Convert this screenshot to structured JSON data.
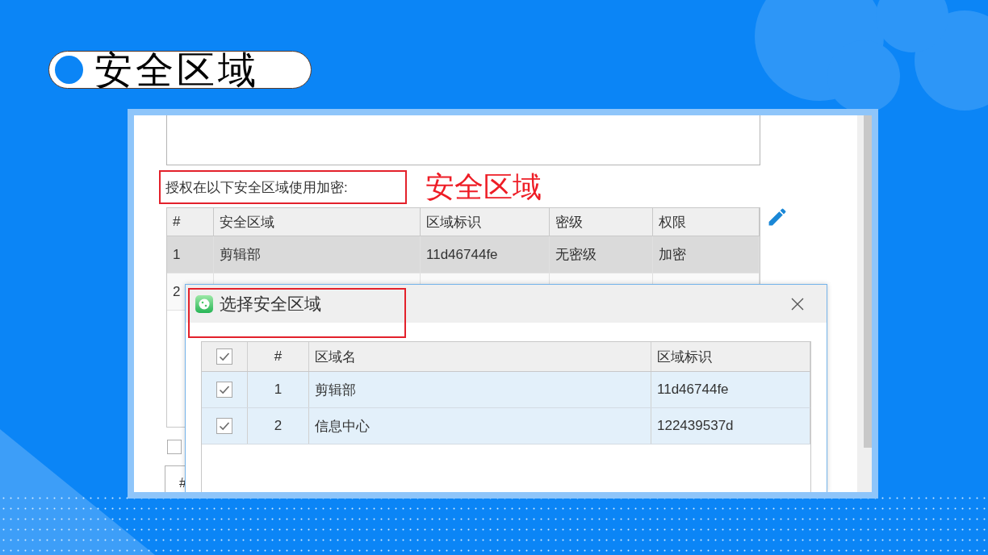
{
  "title_badge": {
    "text": "安全区域"
  },
  "screenshot": {
    "auth_label": "授权在以下安全区域使用加密:",
    "annotation": "安全区域",
    "zones_table": {
      "columns": [
        "#",
        "安全区域",
        "区域标识",
        "密级",
        "权限"
      ],
      "rows": [
        {
          "cells": [
            "1",
            "剪辑部",
            "11d46744fe",
            "无密级",
            "加密"
          ],
          "selected": true
        },
        {
          "cells": [
            "2"
          ],
          "selected": false
        }
      ]
    },
    "option_checkbox": {
      "checked": false
    },
    "lower_table": {
      "columns": [
        "#"
      ]
    },
    "dialog": {
      "title": "选择安全区域",
      "table": {
        "header_checked": true,
        "columns": [
          "#",
          "区域名",
          "区域标识"
        ],
        "rows": [
          {
            "checked": true,
            "cells": [
              "1",
              "剪辑部",
              "11d46744fe"
            ]
          },
          {
            "checked": true,
            "cells": [
              "2",
              "信息中心",
              "122439537d"
            ]
          }
        ]
      }
    }
  }
}
